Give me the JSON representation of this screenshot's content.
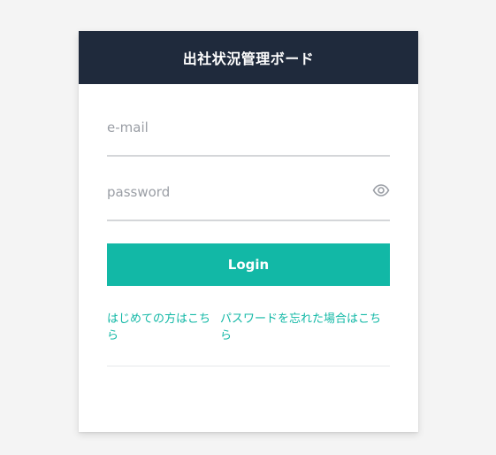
{
  "header": {
    "title": "出社状況管理ボード"
  },
  "form": {
    "email_placeholder": "e-mail",
    "email_value": "",
    "password_placeholder": "password",
    "password_value": "",
    "password_toggle_icon": "eye-icon",
    "login_label": "Login"
  },
  "links": {
    "first_time": "はじめての方はこちら",
    "forgot_password": "パスワードを忘れた場合はこちら"
  },
  "colors": {
    "header_bg": "#1f2a3c",
    "accent": "#12b8a6",
    "page_bg": "#f4f4f4"
  }
}
